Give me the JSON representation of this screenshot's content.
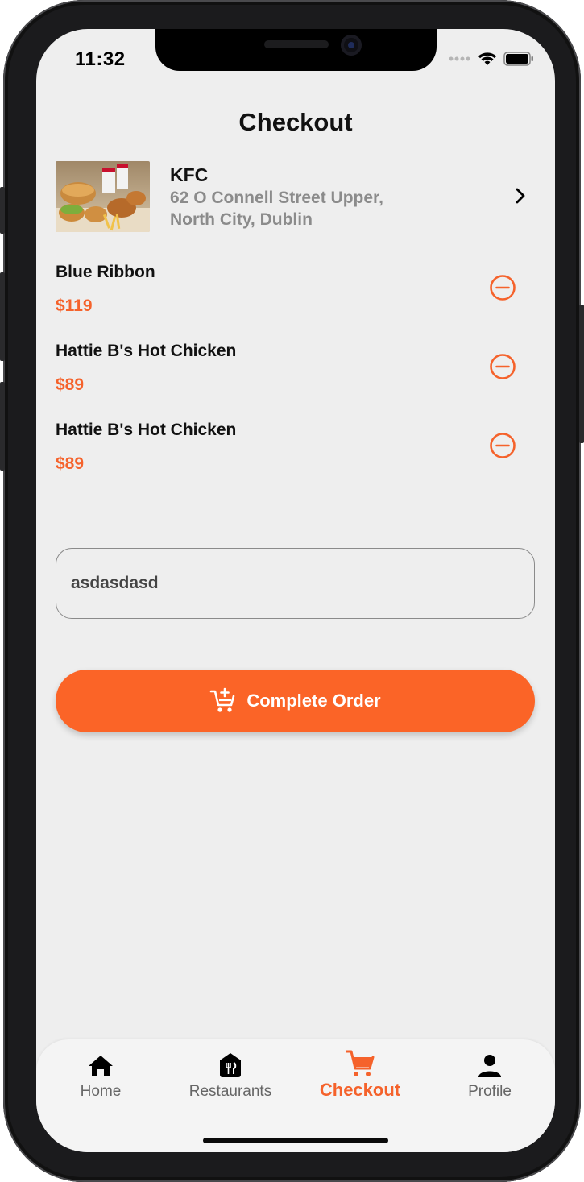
{
  "status": {
    "time": "11:32"
  },
  "page_title": "Checkout",
  "restaurant": {
    "name": "KFC",
    "address_line1": "62 O Connell Street Upper,",
    "address_line2": "North City, Dublin"
  },
  "items": [
    {
      "name": "Blue Ribbon",
      "price": "$119"
    },
    {
      "name": "Hattie B's Hot Chicken",
      "price": "$89"
    },
    {
      "name": "Hattie B's Hot Chicken",
      "price": "$89"
    }
  ],
  "note_input": {
    "value": "asdasdasd"
  },
  "complete_button": {
    "label": "Complete Order",
    "icon": "cart-add-icon"
  },
  "tabs": [
    {
      "label": "Home",
      "icon": "home-icon"
    },
    {
      "label": "Restaurants",
      "icon": "restaurant-icon"
    },
    {
      "label": "Checkout",
      "icon": "cart-icon",
      "active": true
    },
    {
      "label": "Profile",
      "icon": "person-icon"
    }
  ],
  "colors": {
    "accent": "#fb6427",
    "background": "#eeeeee",
    "muted_text": "#8b8b8b"
  }
}
